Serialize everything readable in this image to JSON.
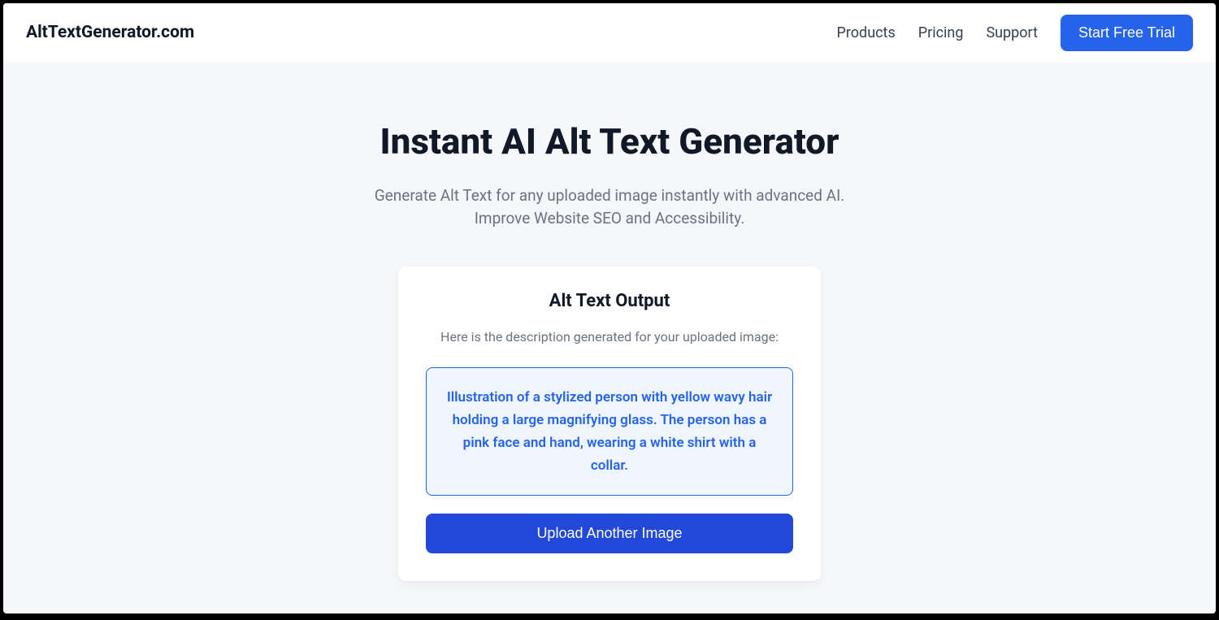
{
  "navbar": {
    "brand": "AltTextGenerator.com",
    "links": {
      "products": "Products",
      "pricing": "Pricing",
      "support": "Support"
    },
    "cta_label": "Start Free Trial"
  },
  "hero": {
    "title": "Instant AI Alt Text Generator",
    "subtitle": "Generate Alt Text for any uploaded image instantly with advanced AI. Improve Website SEO and Accessibility."
  },
  "card": {
    "title": "Alt Text Output",
    "subtitle": "Here is the description generated for your uploaded image:",
    "output_text": "Illustration of a stylized person with yellow wavy hair holding a large magnifying glass. The person has a pink face and hand, wearing a white shirt with a collar.",
    "upload_button_label": "Upload Another Image"
  }
}
